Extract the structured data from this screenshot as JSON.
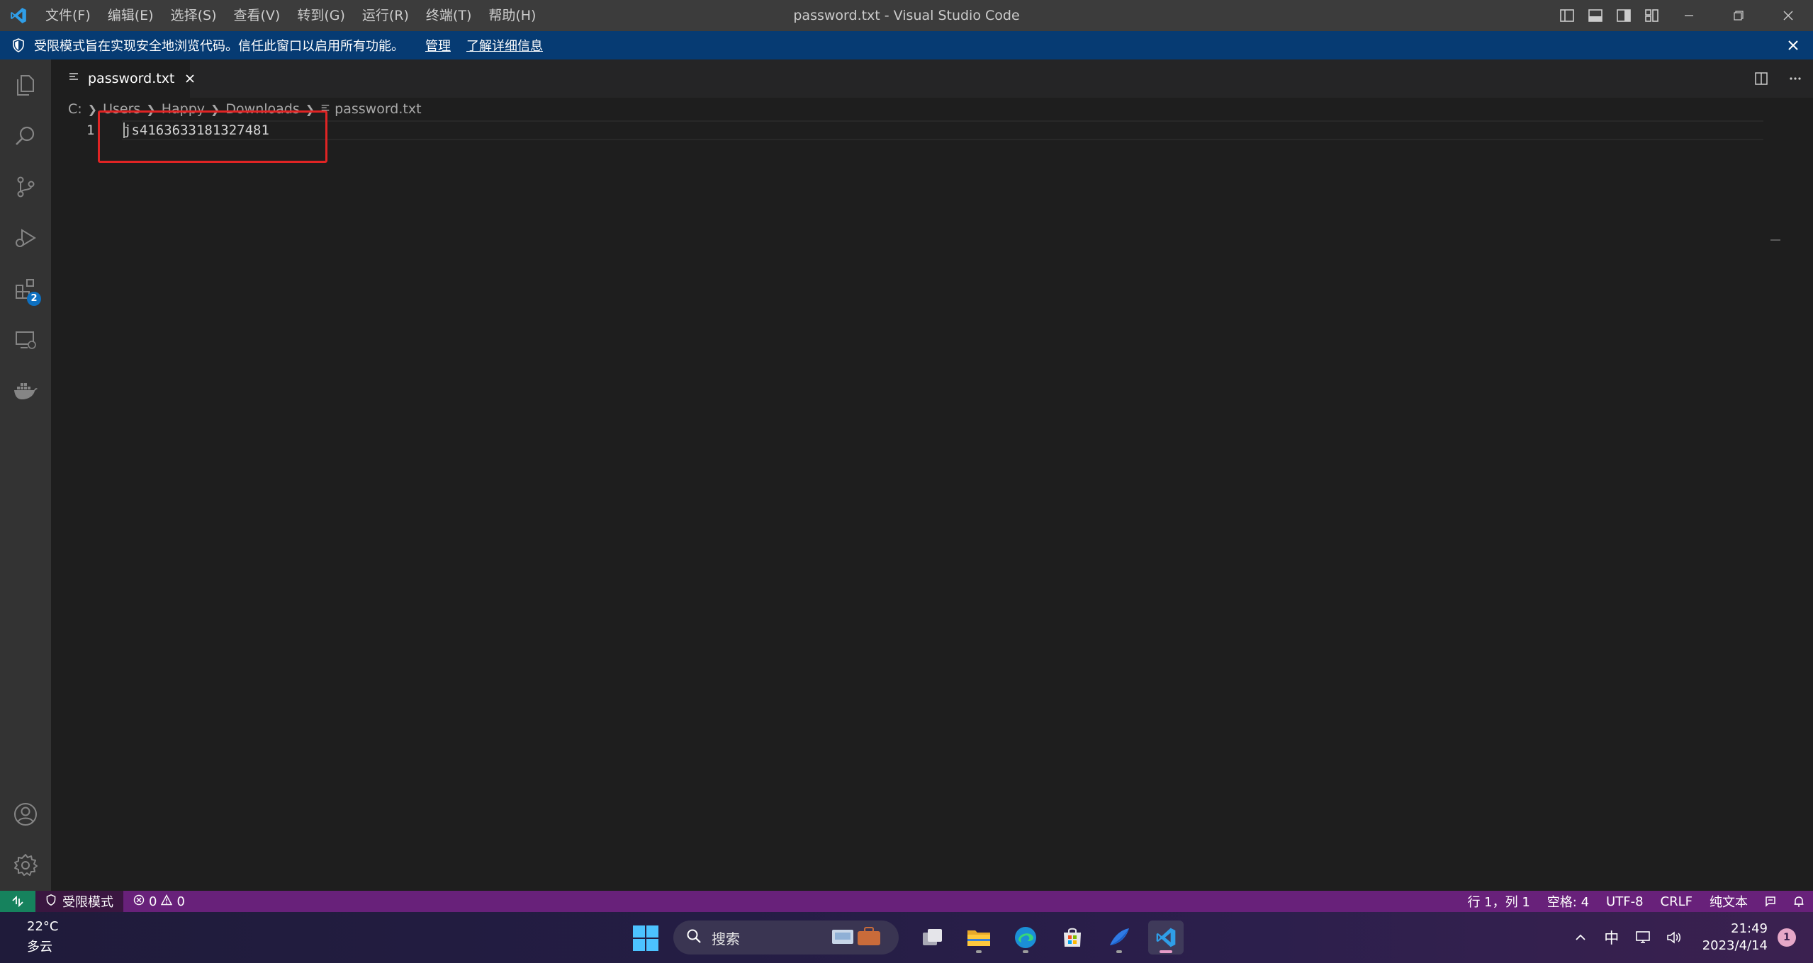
{
  "window": {
    "title": "password.txt - Visual Studio Code",
    "menu": [
      "文件(F)",
      "编辑(E)",
      "选择(S)",
      "查看(V)",
      "转到(G)",
      "运行(R)",
      "终端(T)",
      "帮助(H)"
    ]
  },
  "banner": {
    "message": "受限模式旨在实现安全地浏览代码。信任此窗口以启用所有功能。",
    "manage_link": "管理",
    "learn_more_link": "了解详细信息"
  },
  "activity_bar": {
    "items": [
      "explorer-icon",
      "search-icon",
      "source-control-icon",
      "run-debug-icon",
      "extensions-icon",
      "remote-explorer-icon",
      "docker-icon"
    ],
    "extensions_badge": "2",
    "bottom": [
      "account-icon",
      "settings-gear-icon"
    ]
  },
  "editor": {
    "tab_label": "password.txt",
    "breadcrumb": [
      "C:",
      "Users",
      "Happy",
      "Downloads",
      "password.txt"
    ],
    "line_number": "1",
    "line_content": "js4163633181327481"
  },
  "statusbar": {
    "restricted_label": "受限模式",
    "errors": "0",
    "warnings": "0",
    "cursor_position": "行 1，列 1",
    "indentation": "空格: 4",
    "encoding": "UTF-8",
    "eol": "CRLF",
    "language": "纯文本"
  },
  "taskbar": {
    "weather_temp": "22°C",
    "weather_desc": "多云",
    "search_label": "搜索",
    "ime": "中",
    "time": "21:49",
    "date": "2023/4/14",
    "notification_count": "1"
  },
  "colors": {
    "statusbar_bg": "#68217a",
    "banner_bg": "#063b73",
    "highlight_box": "#e02424"
  }
}
